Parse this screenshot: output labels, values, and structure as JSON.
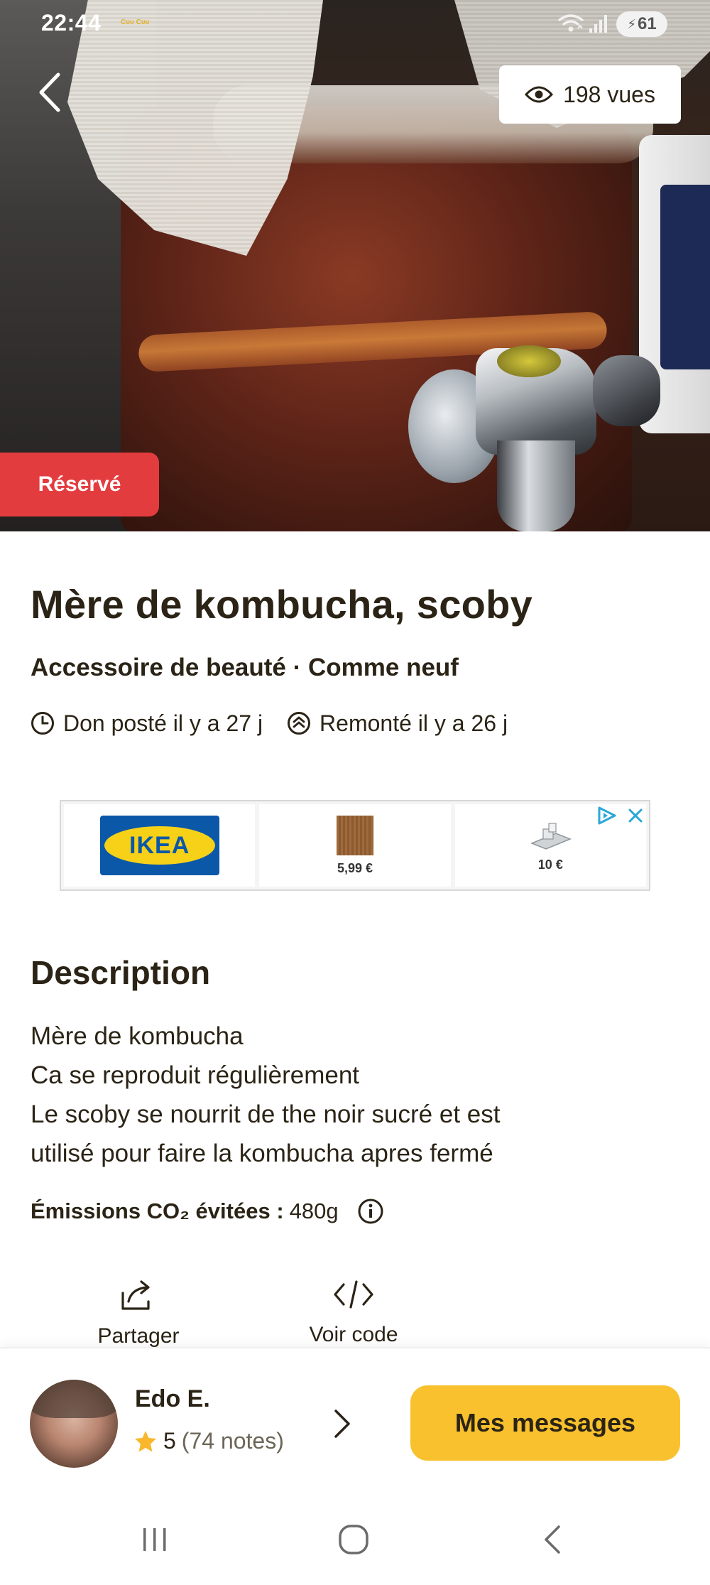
{
  "status_bar": {
    "time": "22:44",
    "notifications": "Cᴜᴜ Cᴜᴜ",
    "battery": "61"
  },
  "header": {
    "views": "198 vues",
    "reserved_badge": "Réservé"
  },
  "listing": {
    "title": "Mère de kombucha,  scoby",
    "subtitle": "Accessoire de beauté · Comme neuf",
    "posted": "Don posté il y a 27 j",
    "bumped": "Remonté il y a 26 j"
  },
  "ad": {
    "brand": "IKEA",
    "items": [
      {
        "price": "5,99 €"
      },
      {
        "price": "10 €"
      }
    ]
  },
  "description": {
    "heading": "Description",
    "lines": [
      "Mère de kombucha",
      "Ca se reproduit régulièrement",
      "Le scoby se nourrit de the noir sucré et est",
      "utilisé pour faire la kombucha apres fermé"
    ]
  },
  "co2": {
    "label": "Émissions CO₂ évitées :",
    "value": "480g"
  },
  "actions": {
    "share": "Partager",
    "code": "Voir code"
  },
  "seller": {
    "name": "Edo E.",
    "rating": "5",
    "rating_count": "(74 notes)"
  },
  "messages_button": "Mes messages",
  "colors": {
    "reserved": "#e33c3f",
    "accent_yellow": "#f8c12d",
    "text": "#2b2416"
  }
}
